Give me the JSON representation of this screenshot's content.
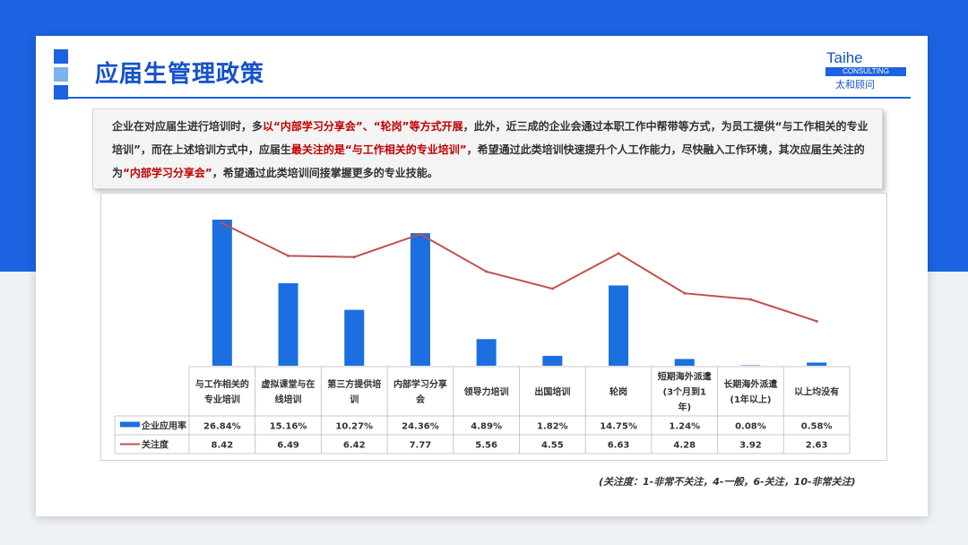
{
  "page": {
    "title": "应届生管理政策",
    "logo": {
      "en": "Taihe",
      "sub": "CONSULTING",
      "cn": "太和顾问"
    },
    "callout": [
      {
        "t": "企业在对应届生进行培训时，多",
        "hl": false
      },
      {
        "t": "以“内部学习分享会”、“轮岗”等方式开展",
        "hl": true
      },
      {
        "t": "，此外，近三成的企业会通过本职工作中帮带等方式，为员工提供“与工作相关的专业培训”，而在上述培训方式中，应届生",
        "hl": false
      },
      {
        "t": "最关注的是“与工作相关的专业培训”",
        "hl": true
      },
      {
        "t": "，希望通过此类培训快速提升个人工作能力，尽快融入工作环境，其次应届生关注的为",
        "hl": false
      },
      {
        "t": "“内部学习分享会”",
        "hl": true
      },
      {
        "t": "，希望通过此类培训间接掌握更多的专业技能。",
        "hl": false
      }
    ],
    "footnote": "(关注度：1-非常不关注，4-一般，6-关注，10-非常关注)"
  },
  "chart_data": {
    "type": "bar",
    "categories": [
      "与工作相关的专业培训",
      "虚拟课堂与在线培训",
      "第三方提供培训",
      "内部学习分享会",
      "领导力培训",
      "出国培训",
      "轮岗",
      "短期海外派遣(3个月到1年)",
      "长期海外派遣(1年以上)",
      "以上均没有"
    ],
    "series": [
      {
        "name": "企业应用率",
        "type": "bar",
        "values": [
          26.84,
          15.16,
          10.27,
          24.36,
          4.89,
          1.82,
          14.75,
          1.24,
          0.08,
          0.58
        ],
        "labels": [
          "26.84%",
          "15.16%",
          "10.27%",
          "24.36%",
          "4.89%",
          "1.82%",
          "14.75%",
          "1.24%",
          "0.08%",
          "0.58%"
        ],
        "color": "#1b6fe0"
      },
      {
        "name": "关注度",
        "type": "line",
        "values": [
          8.42,
          6.49,
          6.42,
          7.77,
          5.56,
          4.55,
          6.63,
          4.28,
          3.92,
          2.63
        ],
        "labels": [
          "8.42",
          "6.49",
          "6.42",
          "7.77",
          "5.56",
          "4.55",
          "6.63",
          "4.28",
          "3.92",
          "2.63"
        ],
        "color": "#c0504d"
      }
    ],
    "ylim_bar": [
      0,
      28
    ],
    "ylim_line": [
      0,
      9
    ]
  }
}
